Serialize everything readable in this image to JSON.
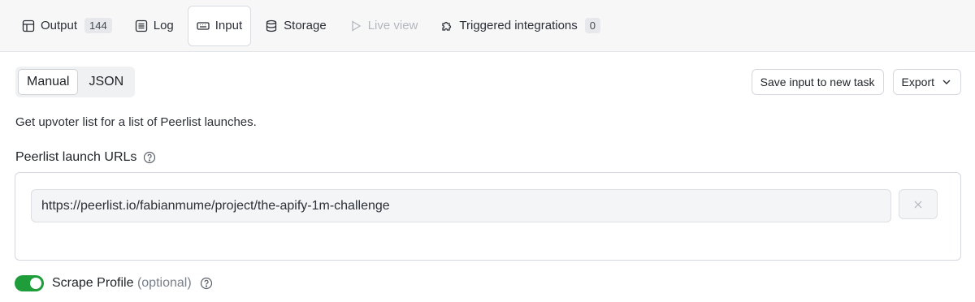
{
  "tabs": [
    {
      "label": "Output",
      "icon": "table-icon",
      "count": "144",
      "active": false,
      "disabled": false
    },
    {
      "label": "Log",
      "icon": "list-icon",
      "active": false,
      "disabled": false
    },
    {
      "label": "Input",
      "icon": "keyboard-icon",
      "active": true,
      "disabled": false
    },
    {
      "label": "Storage",
      "icon": "database-icon",
      "active": false,
      "disabled": false
    },
    {
      "label": "Live view",
      "icon": "play-icon",
      "active": false,
      "disabled": true
    },
    {
      "label": "Triggered integrations",
      "icon": "puzzle-icon",
      "count": "0",
      "active": false,
      "disabled": false
    }
  ],
  "mode": {
    "manual_label": "Manual",
    "json_label": "JSON",
    "selected": "Manual"
  },
  "actions": {
    "save_label": "Save input to new task",
    "export_label": "Export"
  },
  "description": "Get upvoter list for a list of Peerlist launches.",
  "urls_field": {
    "label": "Peerlist launch URLs",
    "value": "https://peerlist.io/fabianmume/project/the-apify-1m-challenge"
  },
  "scrape_profile": {
    "label": "Scrape Profile",
    "optional": "(optional)",
    "enabled": true
  },
  "colors": {
    "toggle_on": "#1f9d3a",
    "tabbar_bg": "#f7f7f8"
  }
}
